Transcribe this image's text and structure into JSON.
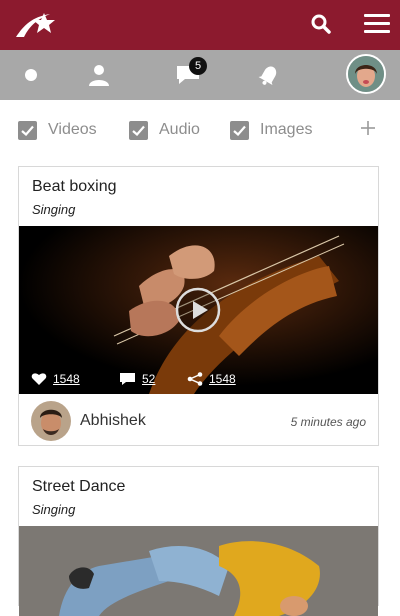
{
  "header": {
    "logo_icon": "star-swoosh-logo",
    "search_icon": "search-icon",
    "menu_icon": "hamburger-menu-icon",
    "background": "#8c1a2e"
  },
  "navbar": {
    "background": "#a8a8a8",
    "items": [
      {
        "icon": "dot-icon"
      },
      {
        "icon": "user-icon"
      },
      {
        "icon": "chat-icon",
        "badge": "5"
      },
      {
        "icon": "bell-icon"
      },
      {
        "icon": "profile-avatar"
      }
    ]
  },
  "filters": {
    "items": [
      {
        "label": "Videos",
        "checked": true
      },
      {
        "label": "Audio",
        "checked": true
      },
      {
        "label": "Images",
        "checked": true
      }
    ],
    "add_icon": "plus-icon"
  },
  "feed": [
    {
      "title": "Beat boxing",
      "category": "Singing",
      "media": "violin-video-thumbnail",
      "likes": "1548",
      "comments": "52",
      "shares": "1548",
      "author": "Abhishek",
      "time": "5 minutes ago"
    },
    {
      "title": "Street Dance",
      "category": "Singing",
      "media": "street-dance-image"
    }
  ]
}
